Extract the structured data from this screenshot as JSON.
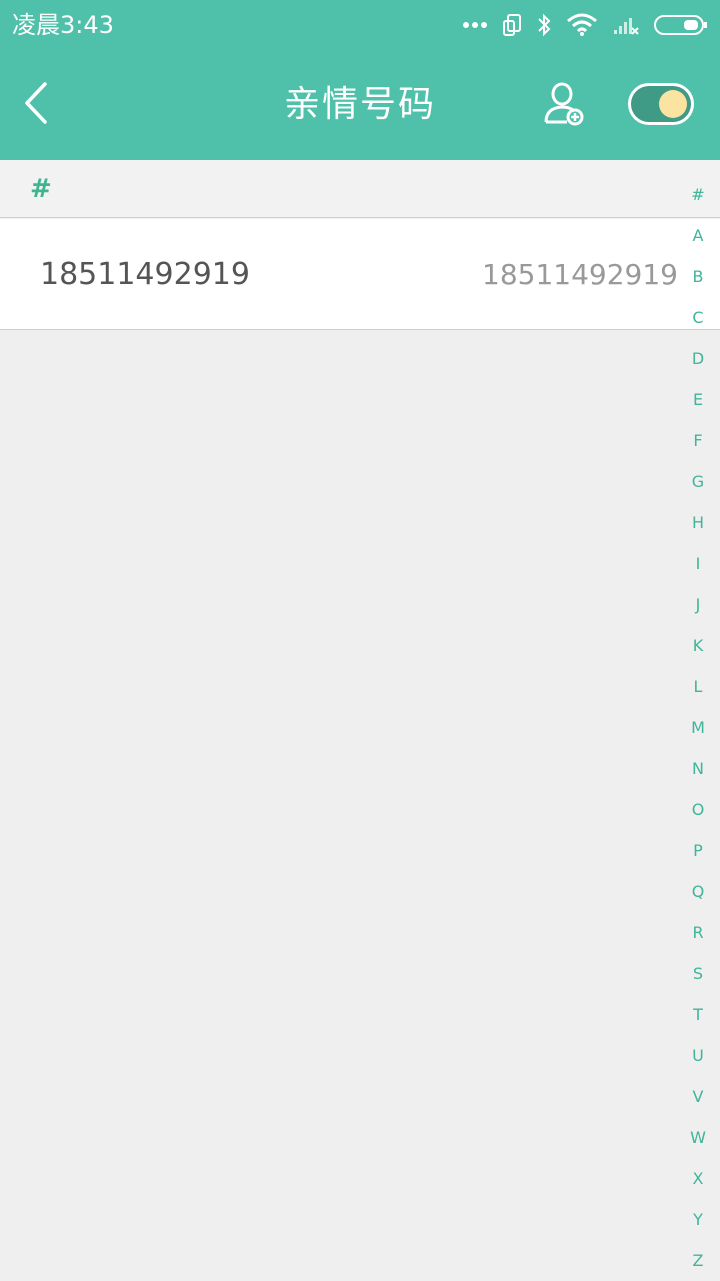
{
  "status_bar": {
    "time": "凌晨3:43",
    "icons": [
      "more-dots-icon",
      "screen-rotate-icon",
      "bluetooth-icon",
      "wifi-icon",
      "signal-icon",
      "battery-icon"
    ]
  },
  "header": {
    "title": "亲情号码",
    "back_icon": "chevron-left-icon",
    "add_icon": "add-user-icon",
    "toggle_on": true
  },
  "sections": [
    {
      "letter": "#",
      "contacts": [
        {
          "name": "18511492919",
          "number": "18511492919"
        }
      ]
    }
  ],
  "index_letters": [
    "#",
    "A",
    "B",
    "C",
    "D",
    "E",
    "F",
    "G",
    "H",
    "I",
    "J",
    "K",
    "L",
    "M",
    "N",
    "O",
    "P",
    "Q",
    "R",
    "S",
    "T",
    "U",
    "V",
    "W",
    "X",
    "Y",
    "Z"
  ],
  "colors": {
    "primary": "#4fc0aa",
    "accent_text": "#3fb59a",
    "toggle_track": "#3f9a86",
    "toggle_knob": "#fbe3a1",
    "background": "#efefef"
  }
}
